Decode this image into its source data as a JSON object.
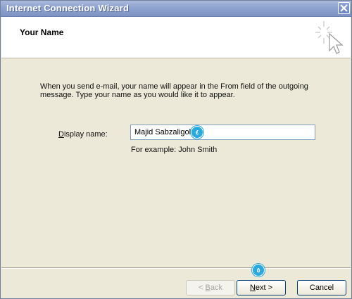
{
  "window": {
    "title": "Internet Connection Wizard"
  },
  "header": {
    "title": "Your Name"
  },
  "content": {
    "description": "When you send e-mail, your name will appear in the From field of the outgoing message. Type your name as you would like it to appear.",
    "display_name_label_accel": "D",
    "display_name_label_rest": "isplay name:",
    "display_name_value": "Majid Sabzaligol",
    "example_text": "For example: John Smith"
  },
  "buttons": {
    "back_accel": "B",
    "back_prefix": "< ",
    "back_rest": "ack",
    "next_accel": "N",
    "next_rest": "ext >",
    "cancel": "Cancel"
  },
  "annotations": {
    "marker_name": "٤",
    "marker_next": "٥"
  },
  "colors": {
    "titlebar": "#8fa3cf",
    "dialog_bg": "#ece9d8",
    "marker": "#29a9e0"
  }
}
